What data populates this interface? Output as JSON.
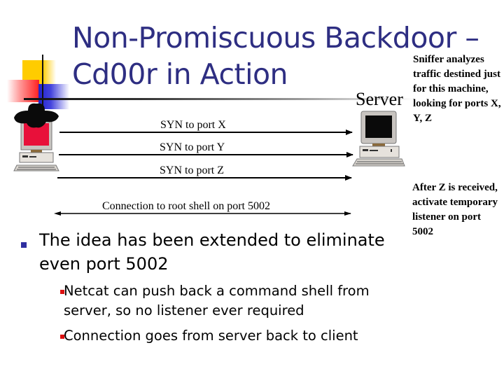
{
  "slide": {
    "title_line1": "Non-Promiscuous Backdoor –",
    "title_line2": "Cd00r in Action",
    "server_label": "Server",
    "sniffer_note": "Sniffer analyzes traffic destined just for this machine, looking for ports X, Y, Z",
    "listener_note": "After Z is received, activate temporary listener on port 5002",
    "arrows": [
      {
        "label": "SYN to port X",
        "direction": "right"
      },
      {
        "label": "SYN to port Y",
        "direction": "right"
      },
      {
        "label": "SYN to port Z",
        "direction": "right"
      },
      {
        "label": "Connection to root shell on port 5002",
        "direction": "both"
      }
    ],
    "bullets": [
      {
        "text": "The idea has been extended to eliminate even port 5002",
        "sub": [
          {
            "text": "Netcat can push back a command shell from server, so no listener ever required"
          },
          {
            "text": "Connection goes from server back to client"
          }
        ]
      }
    ],
    "colors": {
      "title": "#2e2e82",
      "bullet_l1": "#2e2ea0",
      "bullet_l2": "#dd1111",
      "client_screen": "#e8103a"
    },
    "icons": {
      "client": "black-hat-computer-icon",
      "server": "computer-icon"
    }
  }
}
